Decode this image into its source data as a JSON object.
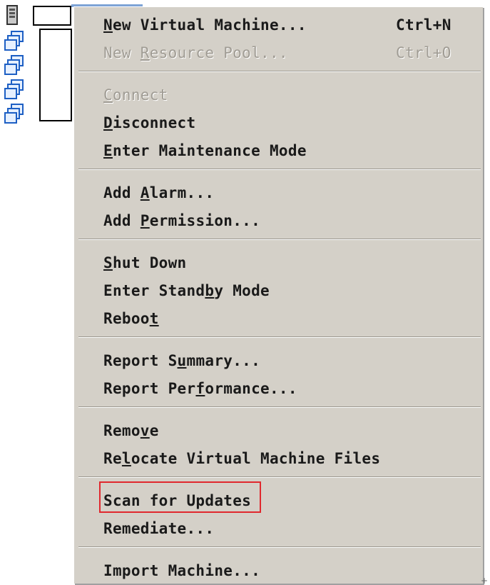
{
  "tree": {
    "icons": [
      "host-icon",
      "vm-group-icon",
      "vm-group-icon",
      "vm-group-icon",
      "vm-group-icon"
    ]
  },
  "context_menu": {
    "items": [
      {
        "label_pre": "",
        "mnemonic": "N",
        "label_post": "ew Virtual Machine...",
        "shortcut": "Ctrl+N",
        "enabled": true
      },
      {
        "label_pre": "New ",
        "mnemonic": "R",
        "label_post": "esource Pool...",
        "shortcut": "Ctrl+O",
        "enabled": false
      },
      {
        "label_pre": "",
        "mnemonic": "C",
        "label_post": "onnect",
        "shortcut": "",
        "enabled": false
      },
      {
        "label_pre": "",
        "mnemonic": "D",
        "label_post": "isconnect",
        "shortcut": "",
        "enabled": true
      },
      {
        "label_pre": "",
        "mnemonic": "E",
        "label_post": "nter Maintenance Mode",
        "shortcut": "",
        "enabled": true
      },
      {
        "label_pre": "Add ",
        "mnemonic": "A",
        "label_post": "larm...",
        "shortcut": "",
        "enabled": true
      },
      {
        "label_pre": "Add ",
        "mnemonic": "P",
        "label_post": "ermission...",
        "shortcut": "",
        "enabled": true
      },
      {
        "label_pre": "",
        "mnemonic": "S",
        "label_post": "hut Down",
        "shortcut": "",
        "enabled": true
      },
      {
        "label_pre": "Enter Stand",
        "mnemonic": "b",
        "label_post": "y Mode",
        "shortcut": "",
        "enabled": true
      },
      {
        "label_pre": "Reboo",
        "mnemonic": "t",
        "label_post": "",
        "shortcut": "",
        "enabled": true
      },
      {
        "label_pre": "Report S",
        "mnemonic": "u",
        "label_post": "mmary...",
        "shortcut": "",
        "enabled": true
      },
      {
        "label_pre": "Report Per",
        "mnemonic": "f",
        "label_post": "ormance...",
        "shortcut": "",
        "enabled": true
      },
      {
        "label_pre": "Remo",
        "mnemonic": "v",
        "label_post": "e",
        "shortcut": "",
        "enabled": true
      },
      {
        "label_pre": "Re",
        "mnemonic": "l",
        "label_post": "ocate Virtual Machine Files",
        "shortcut": "",
        "enabled": true
      },
      {
        "label_pre": "Scan for Updates",
        "mnemonic": "",
        "label_post": "",
        "shortcut": "",
        "enabled": true,
        "highlighted": true
      },
      {
        "label_pre": "Remediate...",
        "mnemonic": "",
        "label_post": "",
        "shortcut": "",
        "enabled": true
      },
      {
        "label_pre": "Import Machine...",
        "mnemonic": "",
        "label_post": "",
        "shortcut": "",
        "enabled": true
      }
    ]
  },
  "colors": {
    "menu_background": "#d4d0c8",
    "highlight_border": "#e0282e",
    "disabled_text": "#a09c94"
  }
}
